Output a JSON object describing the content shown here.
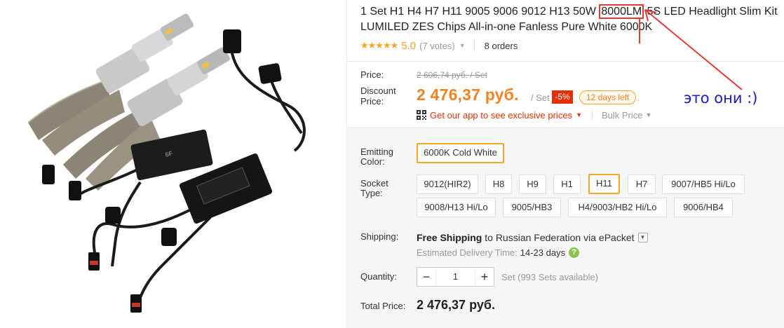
{
  "product": {
    "title_before": "1 Set H1 H4 H7 H11 9005 9006 9012 H13 50W ",
    "title_highlight": "8000LM",
    "title_after": " 5S LED Headlight Slim Kit LUMILED ZES Chips All-in-one Fanless Pure White 6000K",
    "image_icon": "led-headlight-kit-photo"
  },
  "rating": {
    "stars": "★★★★★",
    "score": "5.0",
    "votes": "(7 votes)",
    "orders": "8 orders"
  },
  "price": {
    "price_label": "Price:",
    "old_price": "2 606,74 руб. / Set",
    "discount_label_1": "Discount",
    "discount_label_2": "Price:",
    "current_price": "2 476,37 руб.",
    "per_unit": "/ Set",
    "discount_pct": "-5%",
    "days_left": "12 days left",
    "app_promo": "Get our app to see exclusive prices",
    "bulk_price": "Bulk Price"
  },
  "options": {
    "color_label_1": "Emitting",
    "color_label_2": "Color:",
    "color_selected": "6000K Cold White",
    "socket_label_1": "Socket",
    "socket_label_2": "Type:",
    "sockets": [
      "9012(HIR2)",
      "H8",
      "H9",
      "H1",
      "H11",
      "H7",
      "9007/HB5 Hi/Lo",
      "9008/H13 Hi/Lo",
      "9005/HB3",
      "H4/9003/HB2 Hi/Lo",
      "9006/HB4"
    ],
    "socket_selected": "H11"
  },
  "shipping": {
    "label": "Shipping:",
    "free": "Free Shipping",
    "to": " to ",
    "country": "Russian Federation",
    "via": " via ",
    "carrier": "ePacket",
    "eta_label": "Estimated Delivery Time:",
    "eta_value": "14-23 days"
  },
  "quantity": {
    "label": "Quantity:",
    "value": "1",
    "minus": "−",
    "plus": "+",
    "available": "Set (993 Sets available)"
  },
  "total": {
    "label": "Total Price:",
    "value": "2 476,37 руб."
  },
  "annotation": {
    "text": "это они :)",
    "color": "#1a1acc",
    "arrow_color": "#e53935"
  },
  "colors": {
    "accent_orange": "#f5821f",
    "badge_red": "#e62e04",
    "star": "#f5a623"
  }
}
